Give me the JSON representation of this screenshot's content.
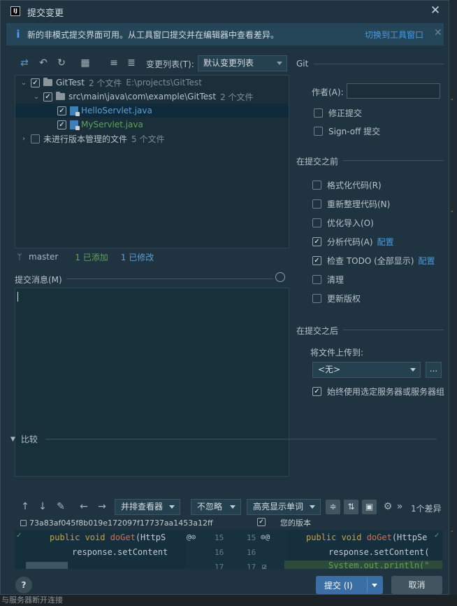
{
  "window": {
    "title": "提交变更",
    "app_icon_text": "IJ"
  },
  "banner": {
    "text": "新的非模式提交界面可用。从工具窗口提交并在编辑器中查看差异。",
    "link": "切换到工具窗口"
  },
  "toolbar": {
    "changelist_label": "变更列表(T):",
    "changelist_value": "默认变更列表"
  },
  "tree": {
    "root": {
      "name": "GitTest",
      "count": "2 个文件",
      "path": "E:\\projects\\GitTest"
    },
    "folder": {
      "name": "src\\main\\java\\com\\example\\GitTest",
      "count": "2 个文件"
    },
    "files": [
      {
        "name": "HelloServlet.java",
        "status": "modified"
      },
      {
        "name": "MyServlet.java",
        "status": "added"
      }
    ],
    "unversioned": {
      "name": "未进行版本管理的文件",
      "count": "5 个文件"
    }
  },
  "status": {
    "branch": "master",
    "added": "1 已添加",
    "modified": "1 已修改"
  },
  "commit_message": {
    "label": "提交消息(M)",
    "value": ""
  },
  "git": {
    "section": "Git",
    "author_label": "作者(A):",
    "author_value": "",
    "amend": "修正提交",
    "signoff": "Sign-off 提交"
  },
  "before_commit": {
    "section": "在提交之前",
    "options": [
      {
        "label": "格式化代码(R)",
        "checked": false
      },
      {
        "label": "重新整理代码(N)",
        "checked": false
      },
      {
        "label": "优化导入(O)",
        "checked": false
      },
      {
        "label": "分析代码(A)",
        "checked": true,
        "link": "配置"
      },
      {
        "label": "检查 TODO (全部显示)",
        "checked": true,
        "link": "配置"
      },
      {
        "label": "清理",
        "checked": false
      },
      {
        "label": "更新版权",
        "checked": false
      }
    ]
  },
  "after_commit": {
    "section": "在提交之后",
    "upload_label": "将文件上传到:",
    "server_value": "<无>",
    "more_button": "...",
    "always_use": "始终使用选定服务器或服务器组"
  },
  "diff": {
    "section": "比较",
    "viewer": "并排查看器",
    "ignore": "不忽略",
    "highlight": "高亮显示单词",
    "count": "1个差异",
    "hash": "73a83af045f8b019e172097f17737aa1453a12ff",
    "yours": "您的版本",
    "left_lines": [
      "public void doGet(HttpS",
      "response.setContent",
      ""
    ],
    "right_lines": [
      "public void doGet(HttpSe",
      "response.setContent(",
      "System.out.println(\""
    ],
    "line_numbers_left": [
      "15",
      "16",
      "17"
    ],
    "line_numbers_right": [
      "15",
      "16",
      "17"
    ]
  },
  "footer": {
    "help": "?",
    "commit": "提交 (I)",
    "cancel": "取消"
  },
  "background": {
    "bottom_text": "与服务器断开连接"
  }
}
